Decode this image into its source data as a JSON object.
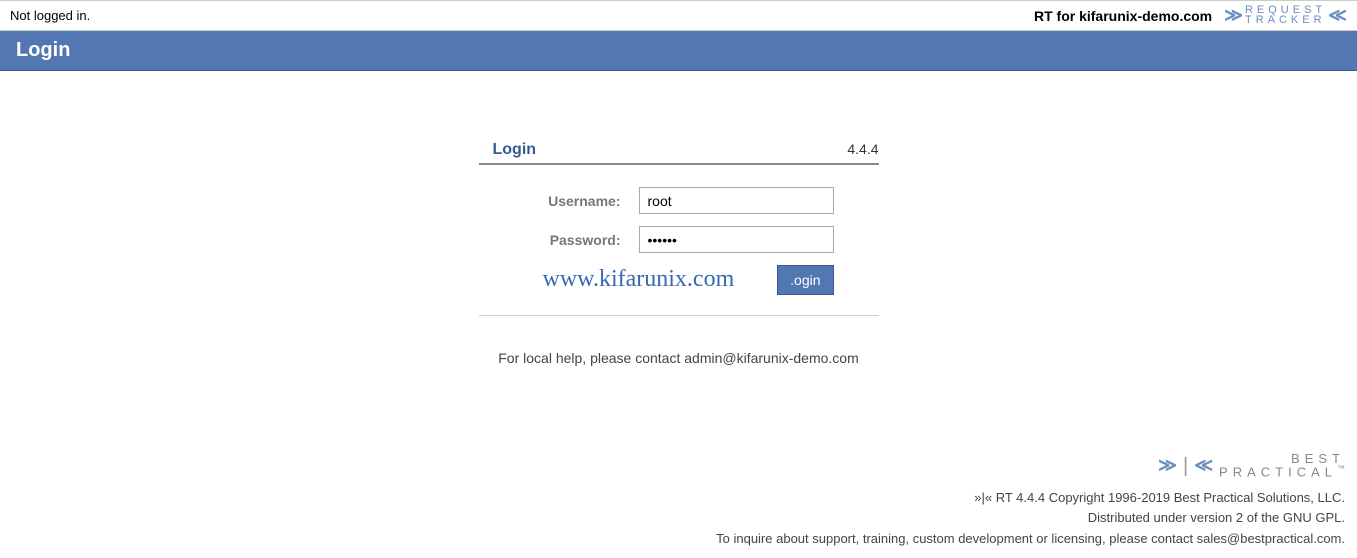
{
  "topbar": {
    "status_text": "Not logged in.",
    "site_title": "RT for kifarunix-demo.com",
    "logo_line1": "REQUEST",
    "logo_line2": "TRACKER"
  },
  "title_band": {
    "title": "Login"
  },
  "login_box": {
    "title": "Login",
    "version": "4.4.4",
    "username_label": "Username:",
    "username_value": "root",
    "password_label": "Password:",
    "password_value": "••••••",
    "watermark": "www.kifarunix.com",
    "submit_label": ".ogin"
  },
  "help": {
    "text": "For local help, please contact admin@kifarunix-demo.com"
  },
  "footer": {
    "bp_line1": "BEST",
    "bp_line2": "PRACTICAL",
    "tm": "™",
    "copyright": "»|« RT 4.4.4 Copyright 1996-2019 Best Practical Solutions, LLC.",
    "license": "Distributed under version 2 of the GNU GPL.",
    "contact": "To inquire about support, training, custom development or licensing, please contact sales@bestpractical.com."
  }
}
